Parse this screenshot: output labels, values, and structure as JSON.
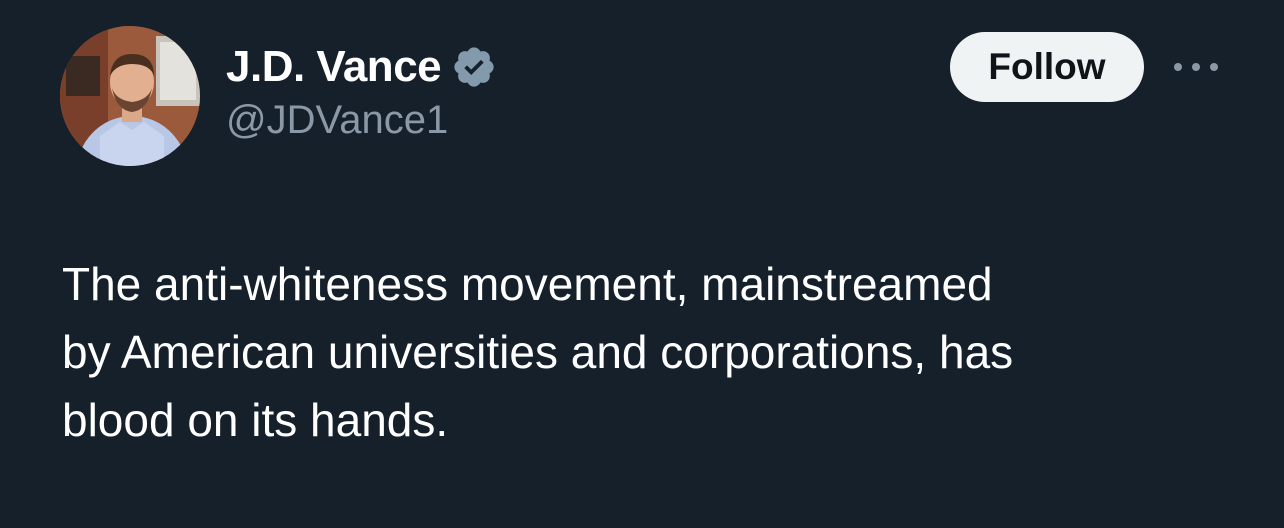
{
  "author": {
    "display_name": "J.D. Vance",
    "handle": "@JDVance1",
    "avatar_icon": "profile-photo",
    "verified_icon": "verified-badge-icon",
    "verified_color": "#829aab"
  },
  "actions": {
    "follow_label": "Follow",
    "more_icon": "more-options-icon"
  },
  "tweet": {
    "text": "The anti-whiteness movement, mainstreamed\nby American universities and corporations, has\nblood on its hands."
  },
  "theme": {
    "background": "#15202b",
    "text_primary": "#ffffff",
    "text_secondary": "#8b98a5",
    "button_bg": "#eff3f4"
  }
}
